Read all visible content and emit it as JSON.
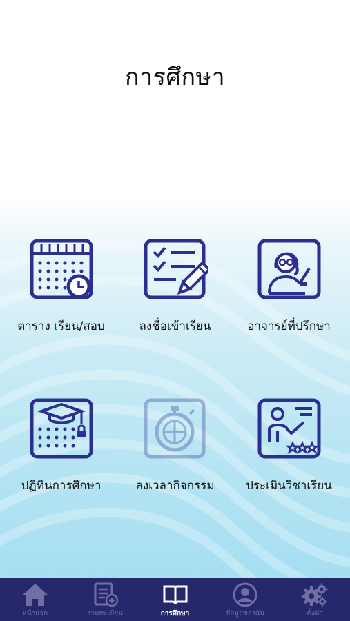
{
  "page": {
    "title": "การศึกษา"
  },
  "tiles": [
    {
      "label": "ตาราง เรียน/สอบ",
      "icon": "calendar-clock-icon",
      "enabled": true
    },
    {
      "label": "ลงชื่อเข้าเรียน",
      "icon": "checklist-pen-icon",
      "enabled": true
    },
    {
      "label": "อาจารย์ที่ปรึกษา",
      "icon": "teacher-icon",
      "enabled": true
    },
    {
      "label": "ปฏิทินการศึกษา",
      "icon": "graduation-calendar-icon",
      "enabled": true
    },
    {
      "label": "ลงเวลากิจกรรม",
      "icon": "stopwatch-icon",
      "enabled": false
    },
    {
      "label": "ประเมินวิชาเรียน",
      "icon": "evaluation-board-icon",
      "enabled": true
    }
  ],
  "tabbar": {
    "items": [
      {
        "label": "หน้าแรก",
        "icon": "home-icon",
        "active": false
      },
      {
        "label": "งานทะเบียน",
        "icon": "registration-icon",
        "active": false
      },
      {
        "label": "การศึกษา",
        "icon": "book-icon",
        "active": true
      },
      {
        "label": "ข้อมูลของฉัน",
        "icon": "profile-icon",
        "active": false
      },
      {
        "label": "ตั้งค่า",
        "icon": "gear-icon",
        "active": false
      }
    ]
  },
  "colors": {
    "primary": "#2b2f8f",
    "tabbar_bg": "#27286b",
    "tab_inactive": "#6f6fa6",
    "background_gradient_end": "#a6def1"
  }
}
